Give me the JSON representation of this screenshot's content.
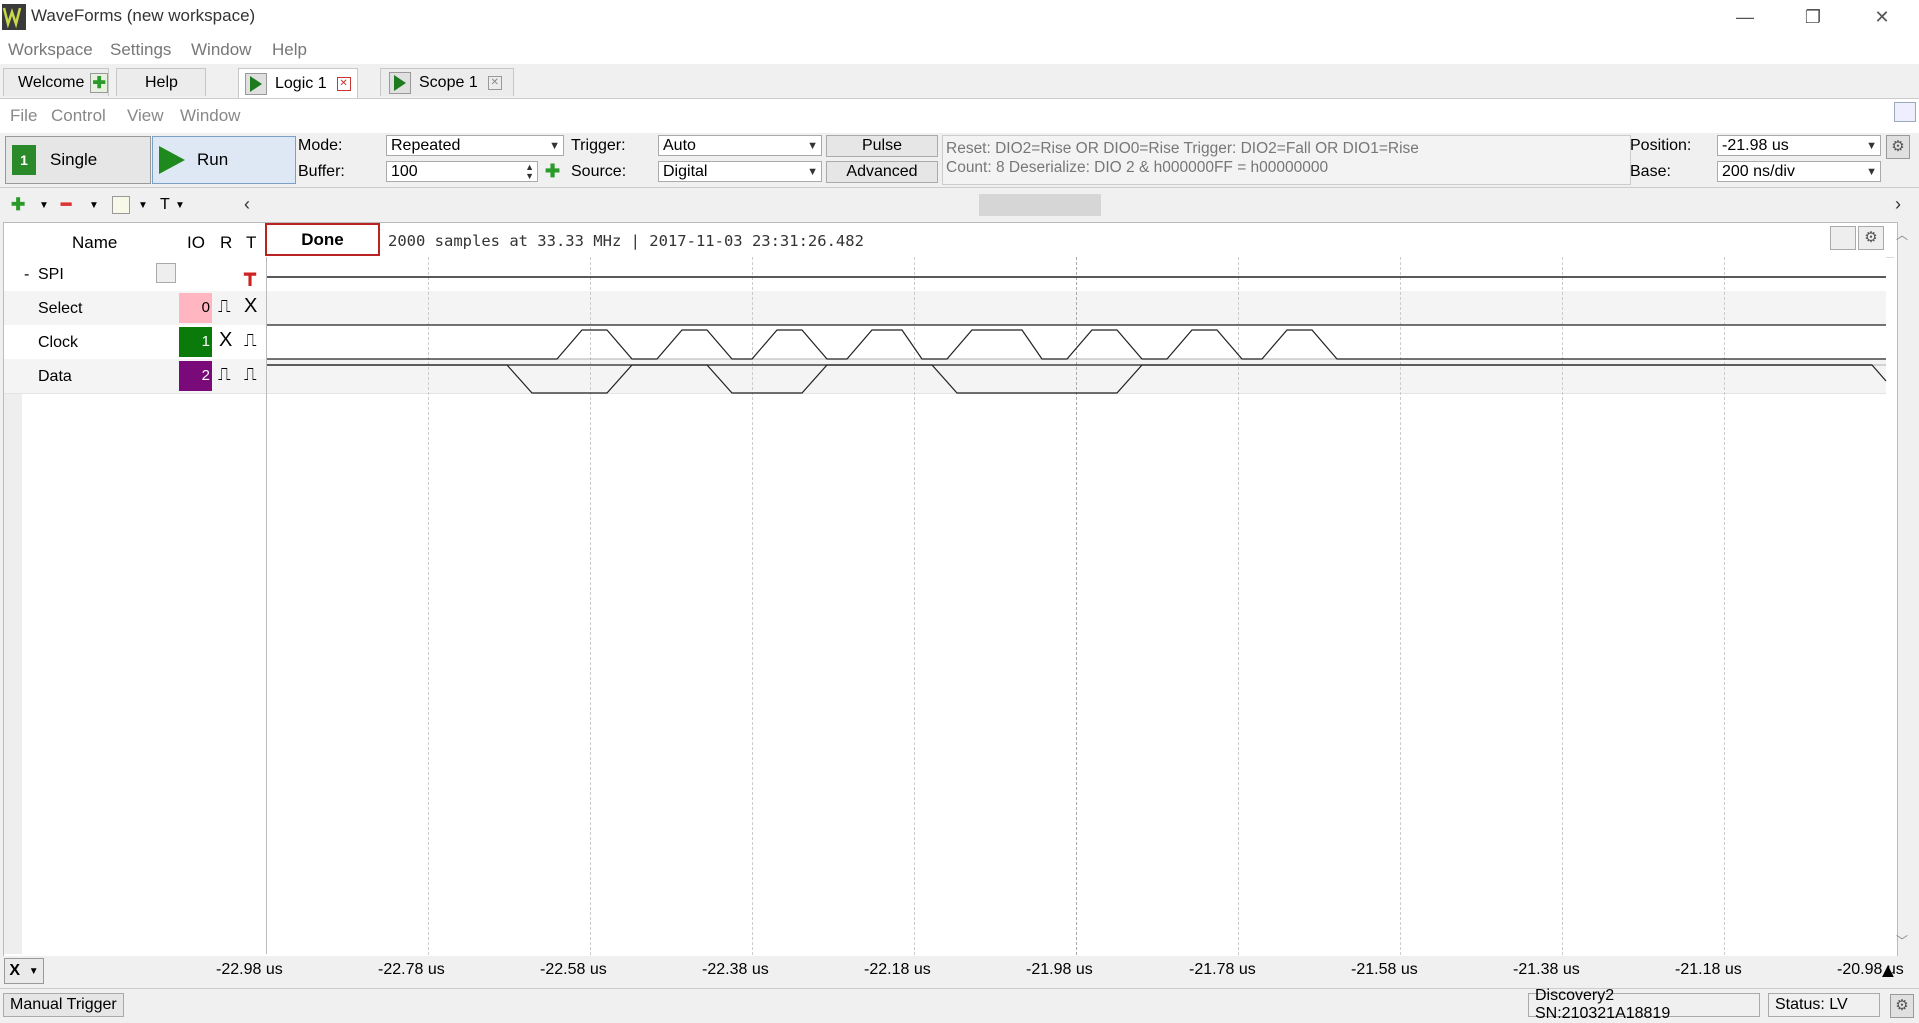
{
  "window": {
    "title": "WaveForms  (new workspace)",
    "min_icon": "minimize-icon",
    "restore_icon": "restore-icon",
    "close_icon": "close-icon"
  },
  "menubar": [
    "Workspace",
    "Settings",
    "Window",
    "Help"
  ],
  "tabs": [
    {
      "label": "Welcome"
    },
    {
      "label": "Help"
    },
    {
      "label": "Logic 1"
    },
    {
      "label": "Scope 1"
    }
  ],
  "inner_menu": [
    "File",
    "Control",
    "View",
    "Window"
  ],
  "toolbar": {
    "single_label": "Single",
    "run_label": "Run",
    "mode_label": "Mode:",
    "mode_value": "Repeated",
    "buffer_label": "Buffer:",
    "buffer_value": "100",
    "trigger_label": "Trigger:",
    "trigger_value": "Auto",
    "source_label": "Source:",
    "source_value": "Digital",
    "pulse_label": "Pulse",
    "advanced_label": "Advanced",
    "info_line1": "Reset: DIO2=Rise OR DIO0=Rise Trigger: DIO2=Fall OR DIO1=Rise",
    "info_line2": "Count: 8  Deserialize: DIO 2  & h000000FF = h00000000",
    "position_label": "Position:",
    "position_value": "-21.98 us",
    "base_label": "Base:",
    "base_value": "200 ns/div"
  },
  "iconrow": {
    "t_label": "T"
  },
  "plot": {
    "headers": {
      "name": "Name",
      "io": "IO",
      "r": "R",
      "t": "T"
    },
    "status_button": "Done",
    "acq_info": "2000 samples at 33.33 MHz | 2017-11-03 23:31:26.482",
    "rows": [
      {
        "prefix": "-",
        "name": "SPI",
        "io": ""
      },
      {
        "prefix": "",
        "name": "Select",
        "io": "0"
      },
      {
        "prefix": "",
        "name": "Clock",
        "io": "1"
      },
      {
        "prefix": "",
        "name": "Data",
        "io": "2"
      }
    ],
    "io_colors": {
      "select": "#ffb6c1",
      "clock": "#0a7a0a",
      "data": "#7a0a7a"
    }
  },
  "axis": {
    "x_button": "X",
    "ticks": [
      "-22.98 us",
      "-22.78 us",
      "-22.58 us",
      "-22.38 us",
      "-22.18 us",
      "-21.98 us",
      "-21.78 us",
      "-21.58 us",
      "-21.38 us",
      "-21.18 us",
      "-20.98 us"
    ]
  },
  "status": {
    "manual_trigger": "Manual Trigger",
    "device": "Discovery2 SN:210321A18819",
    "status_text": "Status: LV"
  }
}
